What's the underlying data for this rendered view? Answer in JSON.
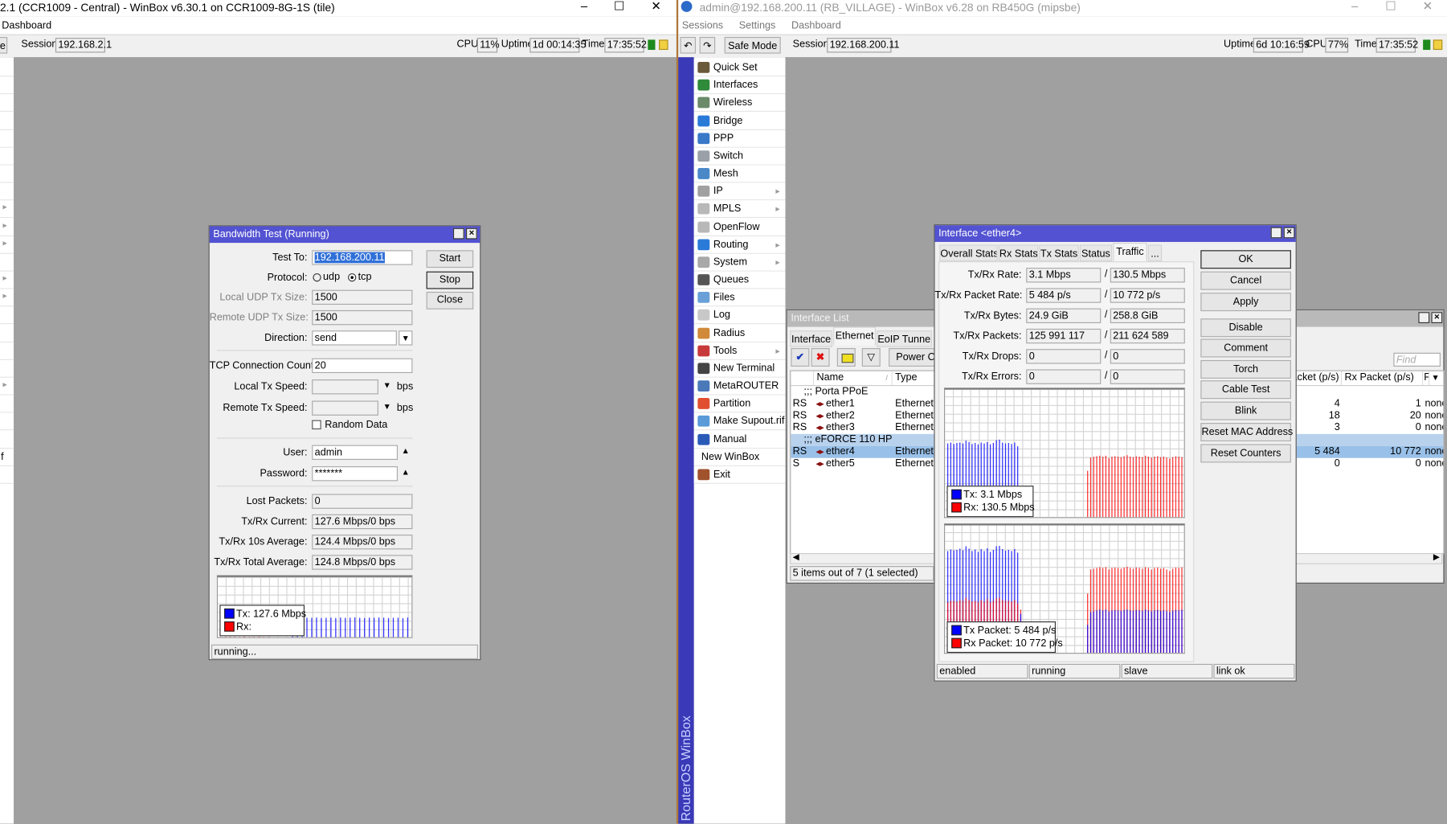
{
  "left_window": {
    "title": "2.1 (CCR1009 - Central) - WinBox v6.30.1 on CCR1009-8G-1S (tile)",
    "menu": [
      "Dashboard"
    ],
    "toolbar": {
      "safe_mode_label": "Safe Mode",
      "session_label": "Session:",
      "session_value": "192.168.2.1",
      "cpu_label": "CPU:",
      "cpu_value": "11%",
      "uptime_label": "Uptime:",
      "uptime_value": "1d 00:14:35",
      "time_label": "Time:",
      "time_value": "17:35:52"
    },
    "controls": {
      "minimize": "–",
      "maximize": "☐",
      "close": "✕"
    },
    "side_fragment": "f"
  },
  "bandwidth_test": {
    "title": "Bandwidth Test (Running)",
    "fields": {
      "test_to": {
        "label": "Test To:",
        "value": "192.168.200.11"
      },
      "protocol": {
        "label": "Protocol:",
        "options": [
          "udp",
          "tcp"
        ],
        "selected": "tcp"
      },
      "local_udp_tx_size": {
        "label": "Local UDP Tx Size:",
        "value": "1500"
      },
      "remote_udp_tx_size": {
        "label": "Remote UDP Tx Size:",
        "value": "1500"
      },
      "direction": {
        "label": "Direction:",
        "value": "send"
      },
      "tcp_connection_count": {
        "label": "TCP Connection Count:",
        "value": "20"
      },
      "local_tx_speed": {
        "label": "Local Tx Speed:",
        "value": "",
        "unit": "bps"
      },
      "remote_tx_speed": {
        "label": "Remote Tx Speed:",
        "value": "",
        "unit": "bps"
      },
      "random_data": {
        "label": "Random Data",
        "checked": false
      },
      "user": {
        "label": "User:",
        "value": "admin"
      },
      "password": {
        "label": "Password:",
        "value": "*******"
      },
      "lost_packets": {
        "label": "Lost Packets:",
        "value": "0"
      },
      "txrx_current": {
        "label": "Tx/Rx Current:",
        "value": "127.6 Mbps/0 bps"
      },
      "txrx_10s_avg": {
        "label": "Tx/Rx 10s Average:",
        "value": "124.4 Mbps/0 bps"
      },
      "txrx_total_avg": {
        "label": "Tx/Rx Total Average:",
        "value": "124.8 Mbps/0 bps"
      }
    },
    "buttons": {
      "start": "Start",
      "stop": "Stop",
      "close": "Close"
    },
    "status": "running...",
    "graph": {
      "unit": "Mbps",
      "ymax": 380,
      "legend": {
        "tx": "Tx:  127.6 Mbps",
        "rx": "Rx:"
      },
      "tx": [
        0,
        0,
        0,
        0,
        0,
        0,
        0,
        0,
        0,
        0,
        0,
        0,
        0,
        0,
        0,
        124,
        126,
        125,
        127,
        126,
        128,
        125,
        126,
        127,
        125,
        128,
        126,
        127,
        129,
        126,
        125,
        127,
        126,
        128,
        127,
        125,
        126,
        127,
        124,
        128
      ],
      "rx": [
        8,
        8,
        9,
        8,
        8,
        9,
        8,
        8,
        9,
        8,
        8,
        0,
        0,
        0,
        0,
        0,
        0,
        0,
        0,
        0,
        0,
        0,
        0,
        0,
        0,
        0,
        0,
        0,
        0,
        0,
        0,
        0,
        0,
        0,
        0,
        0,
        0,
        0,
        0,
        0
      ]
    }
  },
  "right_window": {
    "title": "admin@192.168.200.11 (RB_VILLAGE) - WinBox v6.28 on RB450G (mipsbe)",
    "menu": [
      "Sessions",
      "Settings",
      "Dashboard"
    ],
    "toolbar": {
      "undo": "↶",
      "redo": "↷",
      "safe_mode_label": "Safe Mode",
      "session_label": "Session:",
      "session_value": "192.168.200.11",
      "uptime_label": "Uptime:",
      "uptime_value": "6d 10:16:59",
      "cpu_label": "CPU:",
      "cpu_value": "77%",
      "time_label": "Time:",
      "time_value": "17:35:52"
    },
    "controls": {
      "minimize": "–",
      "maximize": "☐",
      "close": "✕"
    },
    "brand_strip": "RouterOS WinBox",
    "sidebar": [
      {
        "label": "Quick Set",
        "icon": "quick-set-icon",
        "color": "#6a5a3a"
      },
      {
        "label": "Interfaces",
        "icon": "interfaces-icon",
        "color": "#2f8a3a"
      },
      {
        "label": "Wireless",
        "icon": "wireless-icon",
        "color": "#6a8a6a"
      },
      {
        "label": "Bridge",
        "icon": "bridge-icon",
        "color": "#2a7ad8"
      },
      {
        "label": "PPP",
        "icon": "ppp-icon",
        "color": "#3a78c8"
      },
      {
        "label": "Switch",
        "icon": "switch-icon",
        "color": "#9aa0a8"
      },
      {
        "label": "Mesh",
        "icon": "mesh-icon",
        "color": "#4a88c8"
      },
      {
        "label": "IP",
        "icon": "ip-icon",
        "color": "#a0a0a0",
        "submenu": true
      },
      {
        "label": "MPLS",
        "icon": "mpls-icon",
        "color": "#b8b8b8",
        "submenu": true
      },
      {
        "label": "OpenFlow",
        "icon": "openflow-icon",
        "color": "#b8b8b8"
      },
      {
        "label": "Routing",
        "icon": "routing-icon",
        "color": "#2a7ad8",
        "submenu": true
      },
      {
        "label": "System",
        "icon": "system-icon",
        "color": "#a8a8a8",
        "submenu": true
      },
      {
        "label": "Queues",
        "icon": "queues-icon",
        "color": "#555555"
      },
      {
        "label": "Files",
        "icon": "files-icon",
        "color": "#6aa0d8"
      },
      {
        "label": "Log",
        "icon": "log-icon",
        "color": "#c8c8c8"
      },
      {
        "label": "Radius",
        "icon": "radius-icon",
        "color": "#d08a3a"
      },
      {
        "label": "Tools",
        "icon": "tools-icon",
        "color": "#c83a3a",
        "submenu": true
      },
      {
        "label": "New Terminal",
        "icon": "terminal-icon",
        "color": "#444444"
      },
      {
        "label": "MetaROUTER",
        "icon": "metarouter-icon",
        "color": "#4a78b8"
      },
      {
        "label": "Partition",
        "icon": "partition-icon",
        "color": "#e05030"
      },
      {
        "label": "Make Supout.rif",
        "icon": "supout-icon",
        "color": "#5a9ad8"
      },
      {
        "label": "Manual",
        "icon": "manual-icon",
        "color": "#2a5ab8"
      },
      {
        "label": "New WinBox",
        "icon": "",
        "color": ""
      },
      {
        "label": "Exit",
        "icon": "exit-icon",
        "color": "#a0522d"
      }
    ]
  },
  "interface_list": {
    "title": "Interface List",
    "tabs": [
      "Interface",
      "Ethernet",
      "EoIP Tunnel"
    ],
    "active_tab": "Ethernet",
    "toolbar": {
      "power_cycle": "Power Cycle",
      "find_placeholder": "Find"
    },
    "columns": [
      "",
      "Name",
      "Type",
      "Tx Packet (p/s)",
      "Rx Packet (p/s)",
      "FP"
    ],
    "rows": [
      {
        "comment": ";;; Porta PPoE"
      },
      {
        "flags": "RS",
        "name": "ether1",
        "type": "Ethernet",
        "tx_packet": "4",
        "rx_packet": "1",
        "last": "none"
      },
      {
        "flags": "RS",
        "name": "ether2",
        "type": "Ethernet",
        "tx_packet": "18",
        "rx_packet": "20",
        "last": "none"
      },
      {
        "flags": "RS",
        "name": "ether3",
        "type": "Ethernet",
        "tx_packet": "3",
        "rx_packet": "0",
        "last": "none"
      },
      {
        "comment": ";;; eFORCE 110 HP",
        "selected": true
      },
      {
        "flags": "RS",
        "name": "ether4",
        "type": "Ethernet",
        "tx_packet": "5 484",
        "rx_packet": "10 772",
        "last": "none",
        "selected": true
      },
      {
        "flags": "S",
        "name": "ether5",
        "type": "Ethernet",
        "tx_packet": "0",
        "rx_packet": "0",
        "last": "none"
      }
    ],
    "status": "5 items out of 7 (1 selected)"
  },
  "interface_window": {
    "title": "Interface <ether4>",
    "tabs": [
      "Overall Stats",
      "Rx Stats",
      "Tx Stats",
      "Status",
      "Traffic",
      "..."
    ],
    "active_tab": "Traffic",
    "stats": [
      {
        "label": "Tx/Rx Rate:",
        "tx": "3.1 Mbps",
        "rx": "130.5 Mbps"
      },
      {
        "label": "Tx/Rx Packet Rate:",
        "tx": "5 484 p/s",
        "rx": "10 772 p/s"
      },
      {
        "label": "Tx/Rx Bytes:",
        "tx": "24.9 GiB",
        "rx": "258.8 GiB"
      },
      {
        "label": "Tx/Rx Packets:",
        "tx": "125 991 117",
        "rx": "211 624 589"
      },
      {
        "label": "Tx/Rx Drops:",
        "tx": "0",
        "rx": "0"
      },
      {
        "label": "Tx/Rx Errors:",
        "tx": "0",
        "rx": "0"
      }
    ],
    "slash": "/",
    "buttons": [
      "OK",
      "Cancel",
      "Apply",
      "Disable",
      "Comment",
      "Torch",
      "Cable Test",
      "Blink",
      "Reset MAC Address",
      "Reset Counters"
    ],
    "status": [
      "enabled",
      "running",
      "slave",
      "link ok"
    ],
    "graphs": [
      {
        "unit": "Mbps",
        "ymax": 272,
        "legend": {
          "tx": "Tx:  3.1 Mbps",
          "rx": "Rx:  130.5 Mbps"
        },
        "tx": [
          158,
          160,
          157,
          159,
          160,
          158,
          164,
          161,
          157,
          159,
          156,
          160,
          158,
          161,
          156,
          159,
          165,
          166,
          160,
          158,
          159,
          157,
          160,
          152,
          40,
          0,
          0,
          0,
          0,
          0,
          0,
          0,
          0,
          0,
          0,
          0,
          0,
          0,
          0,
          0,
          0,
          0,
          0,
          0,
          0,
          0,
          0,
          0,
          0,
          0,
          0,
          0,
          0,
          0,
          0,
          0,
          0,
          0,
          0,
          0,
          0,
          0,
          0,
          0,
          0,
          0,
          0,
          0,
          0,
          0,
          0,
          0,
          0,
          0,
          0,
          0,
          0,
          0
        ],
        "rx": [
          2,
          2,
          2,
          2,
          2,
          2,
          2,
          2,
          2,
          2,
          2,
          2,
          2,
          2,
          2,
          2,
          2,
          2,
          2,
          2,
          2,
          2,
          2,
          2,
          2,
          0,
          0,
          0,
          0,
          0,
          0,
          0,
          0,
          0,
          0,
          0,
          0,
          0,
          0,
          0,
          0,
          0,
          0,
          0,
          0,
          0,
          100,
          128,
          130,
          131,
          132,
          130,
          132,
          127,
          130,
          131,
          130,
          129,
          131,
          133,
          130,
          129,
          131,
          130,
          129,
          132,
          130,
          128,
          130,
          131,
          129,
          130,
          128,
          126,
          129,
          131,
          130,
          129
        ]
      },
      {
        "unit": "p/s",
        "ymax": 16000,
        "legend": {
          "tx": "Tx Packet:  5 484 p/s",
          "rx": "Rx Packet:  10 772 p/s"
        },
        "tx": [
          12800,
          13000,
          12900,
          12950,
          13100,
          12900,
          13400,
          13100,
          12800,
          13000,
          12700,
          13050,
          12800,
          13150,
          12700,
          12950,
          13400,
          13450,
          13050,
          12850,
          12950,
          12800,
          13050,
          12600,
          5000,
          0,
          0,
          0,
          0,
          0,
          0,
          0,
          0,
          0,
          0,
          0,
          0,
          0,
          0,
          0,
          0,
          0,
          0,
          0,
          0,
          0,
          3600,
          5200,
          5300,
          5400,
          5500,
          5400,
          5500,
          5300,
          5400,
          5450,
          5400,
          5350,
          5450,
          5500,
          5400,
          5350,
          5450,
          5400,
          5350,
          5500,
          5400,
          5300,
          5400,
          5450,
          5350,
          5400,
          5300,
          5200,
          5350,
          5450,
          5400,
          5484
        ],
        "rx": [
          6400,
          6600,
          6600,
          6500,
          6700,
          6600,
          7000,
          6700,
          6500,
          6600,
          6400,
          6700,
          6500,
          6800,
          6400,
          6600,
          6900,
          7000,
          6700,
          6600,
          6600,
          6500,
          6700,
          6300,
          5500,
          0,
          0,
          0,
          0,
          0,
          0,
          0,
          0,
          0,
          0,
          0,
          0,
          0,
          0,
          0,
          0,
          0,
          0,
          0,
          0,
          0,
          7500,
          10500,
          10600,
          10700,
          10800,
          10700,
          10800,
          10500,
          10700,
          10750,
          10700,
          10600,
          10750,
          10850,
          10700,
          10600,
          10750,
          10700,
          10600,
          10800,
          10700,
          10500,
          10700,
          10750,
          10600,
          10700,
          10500,
          10300,
          10600,
          10750,
          10700,
          10772
        ]
      }
    ]
  },
  "colors": {
    "tx": "#0000ff",
    "rx": "#ff0000",
    "title_active": "#5252d2",
    "workspace": "#a0a0a0",
    "brand_strip": "#3a3ab8",
    "selection": "#99c0e8"
  }
}
